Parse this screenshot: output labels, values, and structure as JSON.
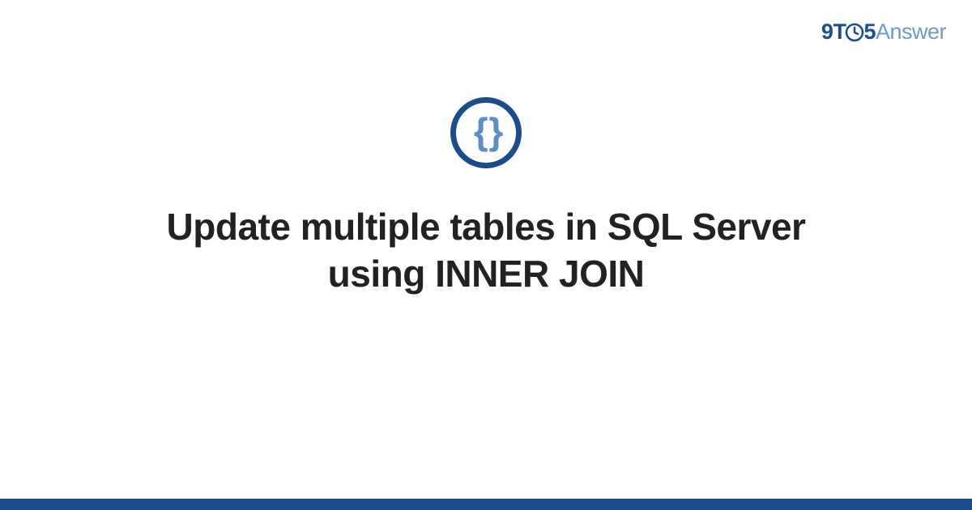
{
  "logo": {
    "part1": "9T",
    "part2": "5",
    "part3": "Answer"
  },
  "icon": {
    "braces": "{ }"
  },
  "title": "Update multiple tables in SQL Server using INNER JOIN",
  "colors": {
    "primary": "#1a4d8f",
    "secondary": "#6b9bd1",
    "text": "#222222"
  }
}
